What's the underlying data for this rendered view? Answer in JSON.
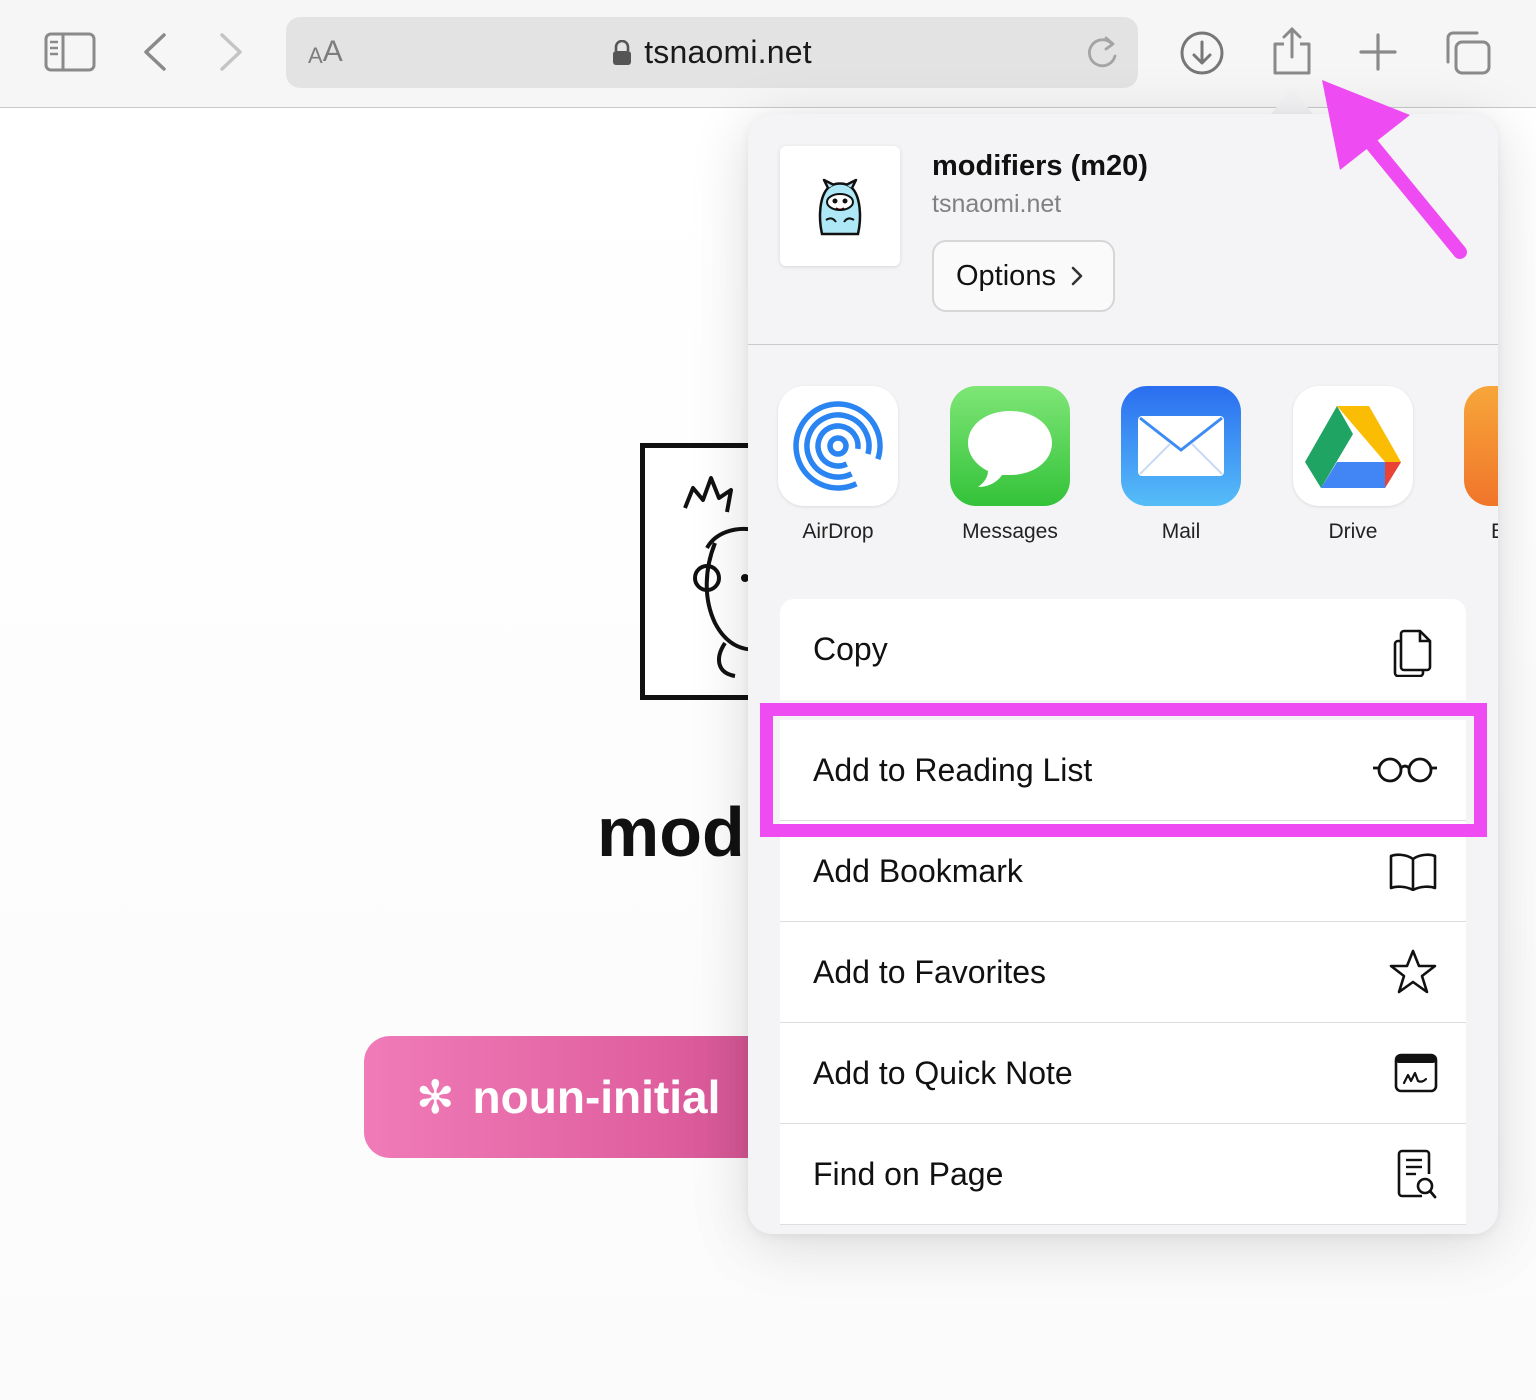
{
  "toolbar": {
    "address_text_small": "A",
    "address_text_big": "A",
    "url": "tsnaomi.net"
  },
  "page": {
    "title": "mod",
    "tag": "noun-initial",
    "tag_symbol": "✻",
    "tag_color": "#e8659f"
  },
  "share_sheet": {
    "title": "modifiers (m20)",
    "subtitle": "tsnaomi.net",
    "options_label": "Options",
    "apps": [
      {
        "label": "AirDrop"
      },
      {
        "label": "Messages"
      },
      {
        "label": "Mail"
      },
      {
        "label": "Drive"
      },
      {
        "label": "B"
      }
    ],
    "actions": [
      {
        "label": "Copy",
        "icon": "copy-icon"
      },
      {
        "label": "Add to Reading List",
        "icon": "glasses-icon"
      },
      {
        "label": "Add Bookmark",
        "icon": "book-icon"
      },
      {
        "label": "Add to Favorites",
        "icon": "star-icon"
      },
      {
        "label": "Add to Quick Note",
        "icon": "quick-note-icon"
      },
      {
        "label": "Find on Page",
        "icon": "find-on-page-icon"
      }
    ]
  },
  "annotation": {
    "color": "#ee4cf2"
  }
}
